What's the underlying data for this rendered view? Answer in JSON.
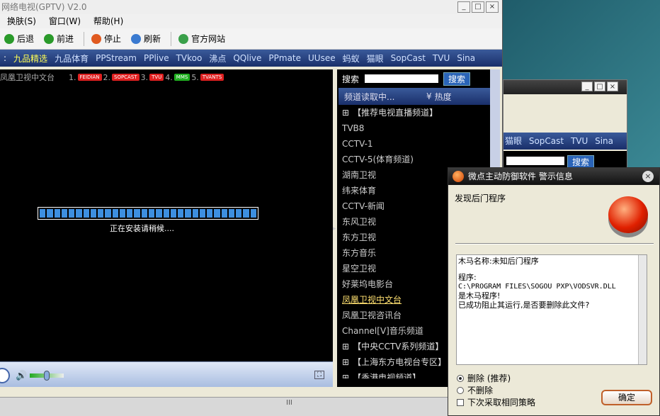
{
  "window": {
    "title": "网络电视(GPTV) V2.0"
  },
  "menu": [
    "换肤(S)",
    "窗口(W)",
    "帮助(H)"
  ],
  "toolbar": {
    "back": "后退",
    "forward": "前进",
    "stop": "停止",
    "refresh": "刷新",
    "site": "官方网站"
  },
  "nav": [
    "九品精选",
    "九品体育",
    "PPStream",
    "PPlive",
    "TVkoo",
    "沸点",
    "QQlive",
    "PPmate",
    "UUsee",
    "蚂蚁",
    "猫眼",
    "SopCast",
    "TVU",
    "Sina"
  ],
  "player": {
    "channel": "凤凰卫视中文台",
    "sources": [
      {
        "n": "1.",
        "t": "FEIDIAN"
      },
      {
        "n": "2.",
        "t": "SOPCAST"
      },
      {
        "n": "3.",
        "t": "TVU"
      },
      {
        "n": "4.",
        "t": "MMS"
      },
      {
        "n": "5.",
        "t": "TVANTS"
      }
    ],
    "status": "正在安装请稍候...."
  },
  "sidebar": {
    "search_label": "搜索",
    "search_btn": "搜索",
    "loading": "频道读取中...",
    "hot": "热度",
    "recommend": "【推荐电视直播频道】",
    "channels": [
      "TVB8",
      "CCTV-1",
      "CCTV-5(体育频道)",
      "湖南卫视",
      "纬来体育",
      "CCTV-新闻",
      "东风卫视",
      "东方卫视",
      "东方音乐",
      "星空卫视",
      "好莱坞电影台",
      "凤凰卫视中文台",
      "凤凰卫视咨讯台",
      "Channel[V]音乐频道"
    ],
    "categories": [
      "【中央CCTV系列频道】",
      "【上海东方电视台专区】",
      "【香港电视频道】"
    ]
  },
  "bg_window": {
    "nav": [
      "猫眼",
      "SopCast",
      "TVU",
      "Sina"
    ],
    "search": "搜索"
  },
  "dialog": {
    "title": "微点主动防御软件  警示信息",
    "found": "发现后门程序",
    "text1": "木马名称:未知后门程序",
    "text2": "程序:",
    "path": "C:\\PROGRAM FILES\\SOGOU PXP\\VODSVR.DLL",
    "text3": "是木马程序!",
    "text4": "已成功阻止其运行,是否要删除此文件?",
    "opt1": "删除 (推荐)",
    "opt2": "不删除",
    "check": "下次采取相同策略",
    "ok": "确定"
  }
}
